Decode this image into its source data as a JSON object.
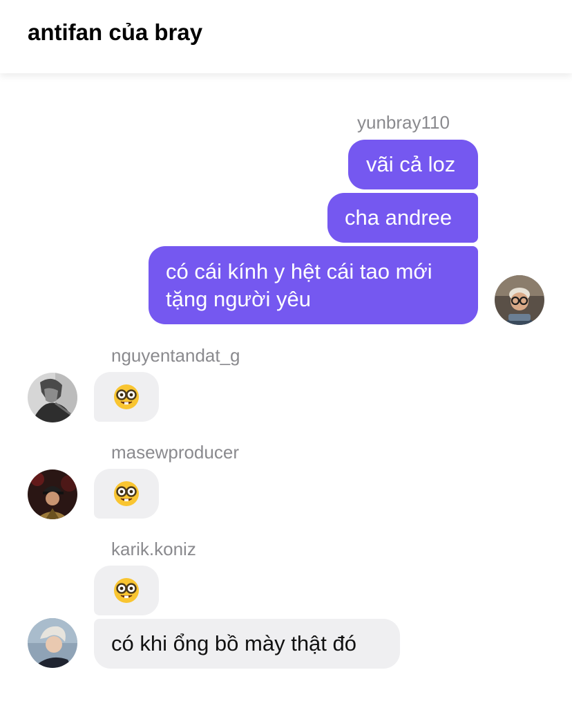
{
  "header": {
    "title": "antifan của bray"
  },
  "messages": {
    "m1": {
      "sender": "yunbray110",
      "text1": "vãi cả loz",
      "text2": "cha andree",
      "text3_line1": "có cái kính y hệt cái tao mới",
      "text3_line2": "tặng người yêu",
      "avatar_icon": "user-avatar-glasses-icon"
    },
    "m2": {
      "sender": "nguyentandat_g",
      "emoji": "nerd-face-emoji",
      "avatar_icon": "user-avatar-grey-icon"
    },
    "m3": {
      "sender": "masewproducer",
      "emoji": "nerd-face-emoji",
      "avatar_icon": "user-avatar-cap-icon"
    },
    "m4": {
      "sender": "karik.koniz",
      "emoji": "nerd-face-emoji",
      "text": "có khi ổng bồ mày thật đó",
      "avatar_icon": "user-avatar-blond-icon"
    }
  },
  "colors": {
    "outgoing_bubble": "#7558f0",
    "incoming_bubble": "#efeff1",
    "username_text": "#8a8a8e"
  }
}
